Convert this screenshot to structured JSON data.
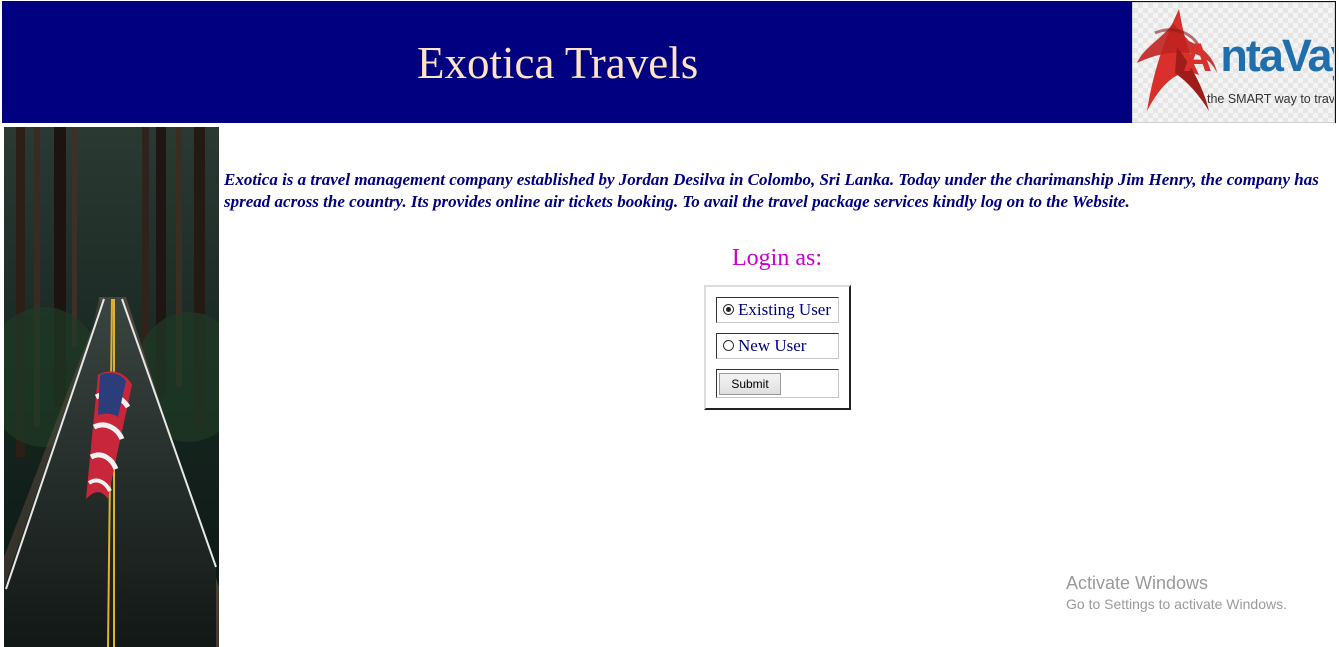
{
  "header": {
    "title": "Exotica Travels",
    "background_color": "#000080",
    "title_color": "#ffe4c4"
  },
  "logo": {
    "brand_icon": "red-star-swoosh-icon",
    "brand_initial": "A",
    "brand_rest": "ntaVaya",
    "tagline": "the SMART way to travel",
    "brand_color": "#1f6fae",
    "accent_color": "#d9302b"
  },
  "side_image": {
    "description_icon": "road-with-flag-photo"
  },
  "intro": {
    "text": "Exotica is a travel management company established by Jordan Desilva in Colombo, Sri Lanka. Today under the charimanship Jim Henry, the company has spread across the country. Its provides online air tickets booking. To avail the travel package services kindly log on to the Website.",
    "color": "#000080"
  },
  "login": {
    "heading": "Login as:",
    "heading_color": "#cc00cc",
    "options": [
      {
        "label": "Existing User",
        "checked": true
      },
      {
        "label": "New User",
        "checked": false
      }
    ],
    "submit_label": "Submit"
  },
  "watermark": {
    "title": "Activate Windows",
    "subtitle": "Go to Settings to activate Windows."
  }
}
